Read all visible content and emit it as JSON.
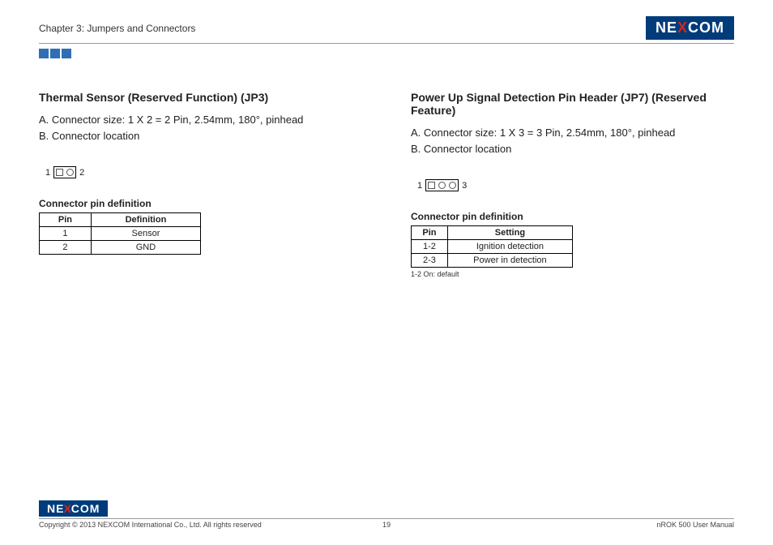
{
  "header": {
    "chapter": "Chapter 3: Jumpers and Connectors",
    "logo_pre": "NE",
    "logo_x": "X",
    "logo_post": "COM"
  },
  "left": {
    "title": "Thermal Sensor (Reserved Function) (JP3)",
    "spec_a": "A. Connector size: 1 X 2 = 2 Pin, 2.54mm, 180°, pinhead",
    "spec_b": "B. Connector location",
    "pin_left": "1",
    "pin_right": "2",
    "table_title": "Connector pin definition",
    "th1": "Pin",
    "th2": "Definition",
    "rows": [
      {
        "pin": "1",
        "def": "Sensor"
      },
      {
        "pin": "2",
        "def": "GND"
      }
    ]
  },
  "right": {
    "title": "Power Up Signal Detection Pin Header (JP7) (Reserved Feature)",
    "spec_a": "A. Connector size: 1 X 3 = 3 Pin, 2.54mm, 180°, pinhead",
    "spec_b": "B. Connector location",
    "pin_left": "1",
    "pin_right": "3",
    "table_title": "Connector pin definition",
    "th1": "Pin",
    "th2": "Setting",
    "rows": [
      {
        "pin": "1-2",
        "def": "Ignition detection"
      },
      {
        "pin": "2-3",
        "def": "Power in detection"
      }
    ],
    "note": "1-2 On: default"
  },
  "footer": {
    "logo_pre": "NE",
    "logo_x": "X",
    "logo_post": "COM",
    "copyright": "Copyright © 2013 NEXCOM International Co., Ltd. All rights reserved",
    "page": "19",
    "manual": "nROK 500 User Manual"
  }
}
